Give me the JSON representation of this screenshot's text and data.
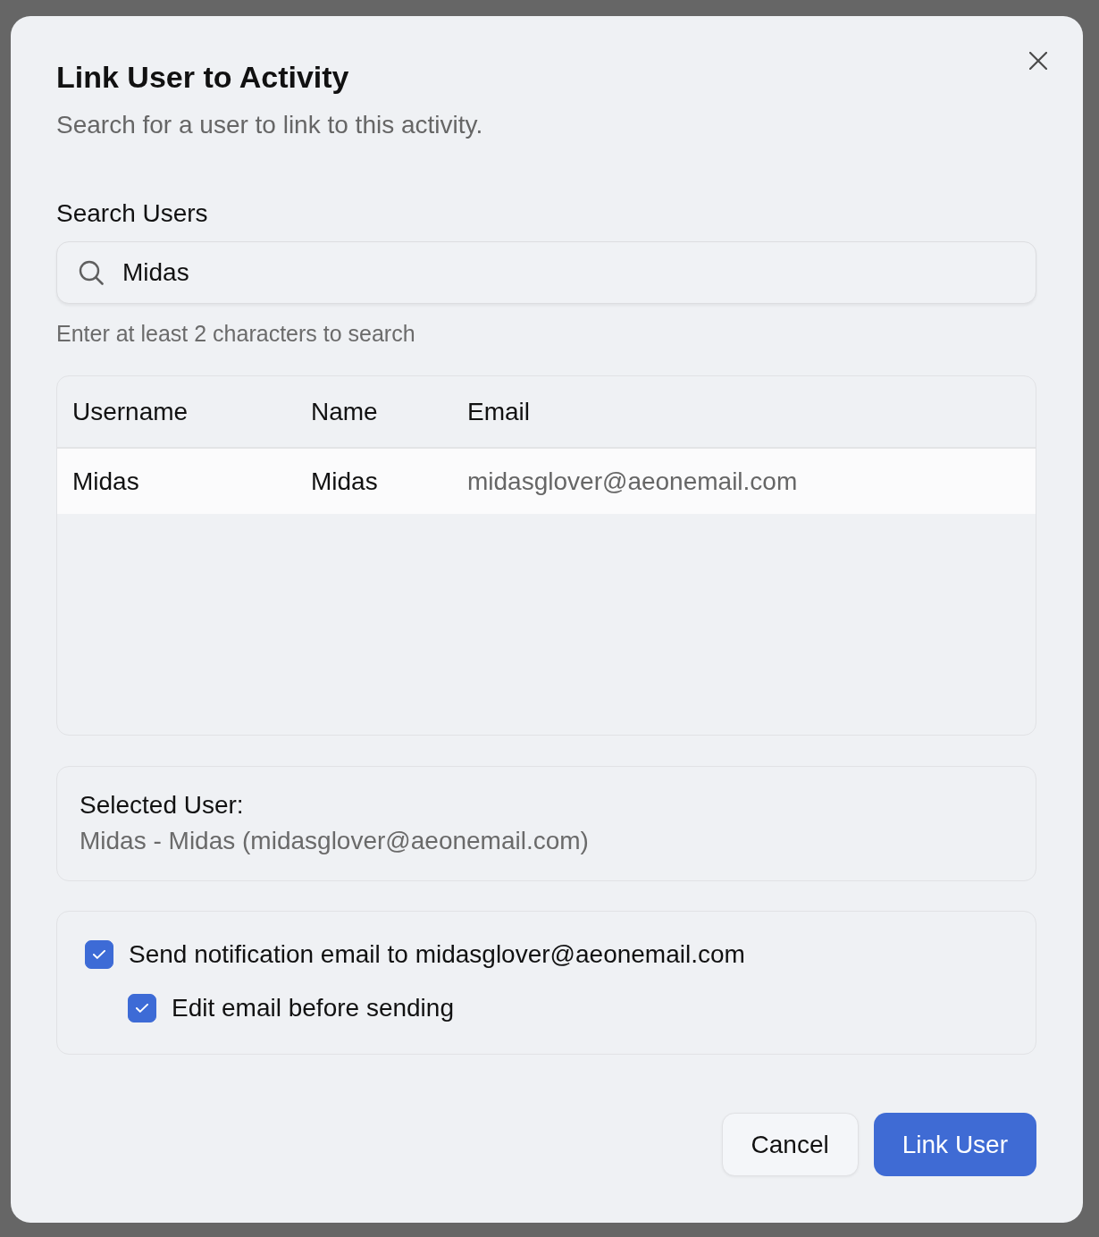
{
  "dialog": {
    "title": "Link User to Activity",
    "subtitle": "Search for a user to link to this activity."
  },
  "search": {
    "label": "Search Users",
    "value": "Midas",
    "hint": "Enter at least 2 characters to search"
  },
  "table": {
    "columns": [
      {
        "label": "Username",
        "kind": "text"
      },
      {
        "label": "Name",
        "kind": "text"
      },
      {
        "label": "Email",
        "kind": "email"
      }
    ],
    "rows": [
      {
        "cells": [
          "Midas",
          "Midas",
          "midasglover@aeonemail.com"
        ],
        "selected": true
      }
    ]
  },
  "selected_user": {
    "label": "Selected User:",
    "value": "Midas - Midas (midasglover@aeonemail.com)"
  },
  "options": [
    {
      "label": "Send notification email to midasglover@aeonemail.com",
      "checked": true,
      "children": [
        {
          "label": "Edit email before sending",
          "checked": true
        }
      ]
    }
  ],
  "buttons": [
    {
      "label": "Cancel",
      "kind": "secondary"
    },
    {
      "label": "Link User",
      "kind": "primary"
    }
  ]
}
